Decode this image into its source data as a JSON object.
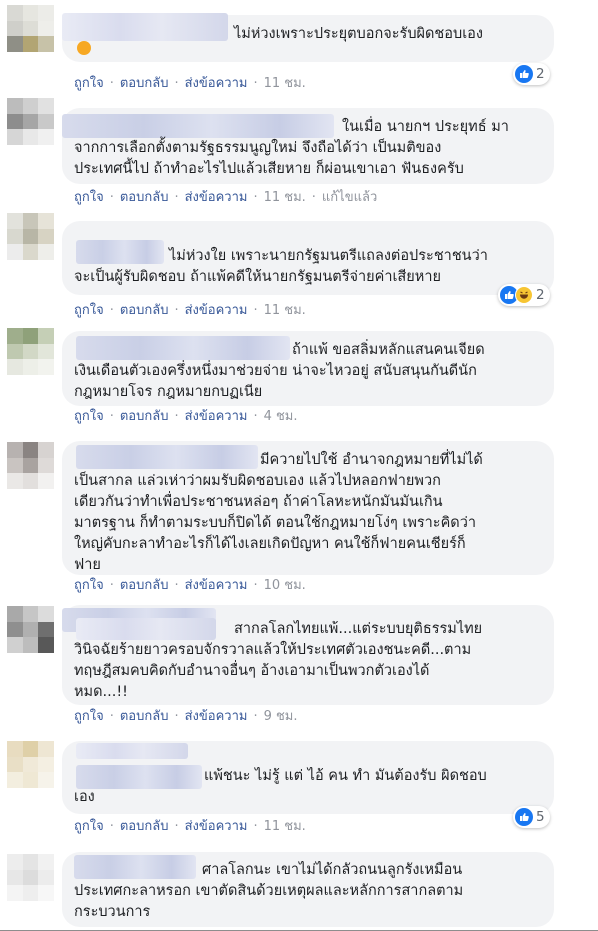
{
  "actions": {
    "like": "ถูกใจ",
    "reply": "ตอบกลับ",
    "message": "ส่งข้อความ",
    "edited": "แก้ไขแล้ว",
    "sep": "·"
  },
  "comments": [
    {
      "text": "ไม่ห่วงเพราะประยุตบอกจะรับผิดชอบเอง",
      "time": "11 ชม.",
      "reactions": "2"
    },
    {
      "text": "ในเมื่อ นายกฯ ประยุทธ์ มา\nจากการเลือกตั้งตามรัฐธรรมนูญใหม่ จึงถือได้ว่า เป็นมติของ\nประเทศนี้ไป ถ้าทำอะไรไปแล้วเสียหาย ก็ผ่อนเขาเอา ฟันธงครับ",
      "time": "11 ชม."
    },
    {
      "text": "ไม่ห่วงใย เพราะนายกรัฐมนตรีแถลงต่อประชาชนว่า\nจะเป็นผู้รับผิดชอบ ถ้าแพ้คดีให้นายกรัฐมนตรีจ่ายค่าเสียหาย",
      "time": "11 ชม.",
      "reactions": "2"
    },
    {
      "text": "ถ้าแพ้ ขอสลิ่มหลักแสนคนเจียด\nเงินเดือนตัวเองครึ่งหนึ่งมาช่วยจ่าย น่าจะไหวอยู่ สนับสนุนกันดีนัก\nกฎหมายโจร กฎหมายกบฏเนีย",
      "time": "4 ชม."
    },
    {
      "text": "มีควายไปใช้ อำนาจกฎหมายที่ไม่ได้\nเป็นสากล แล่วเห่าว่าผมรับผิดชอบเอง แล้วไปหลอกฟายพวก\nเดียวกันว่าทำเพื่อประชาชนหล่อๆ ถ้าค่าโลหะหนักมันมันเกิน\nมาตรฐาน ก็ทำตามระบบก็ปิดได้ ตอนใช้กฎหมายโง่ๆ เพราะคิดว่า\nใหญ่คับกะลาทำอะไรก็ได้ไงเลยเกิดปัญหา คนใช้ก็ฟายคนเชียร์ก็\nฟาย",
      "time": "10 ชม."
    },
    {
      "text": "สากลโลกไทยแพ้...แต่ระบบยุติธรรมไทย\nวินิจฉัยร้ายยาวครอบจักรวาลแล้วให้ประเทศตัวเองชนะคดี...ตาม\nทฤษฎีสมคบคิดกับอำนาจอื่นๆ อ้างเอามาเป็นพวกตัวเองได้\nหมด...!!",
      "time": "9 ชม."
    },
    {
      "text": "แพ้ชนะ ไม่รู้ แต่ ไอ้ คน ทำ มันต้องรับ ผิดชอบ\nเอง",
      "time": "11 ชม.",
      "reactions": "5"
    },
    {
      "text": "ศาลโลกนะ เขาไม่ได้กลัวถนนลูกรังเหมือน\nประเทศกะลาหรอก เขาตัดสินด้วยเหตุผลและหลักการสากลตาม\nกระบวนการ"
    }
  ],
  "colors": {
    "link": "#385898",
    "bubble": "#f2f3f5",
    "like": "#1877f2"
  }
}
